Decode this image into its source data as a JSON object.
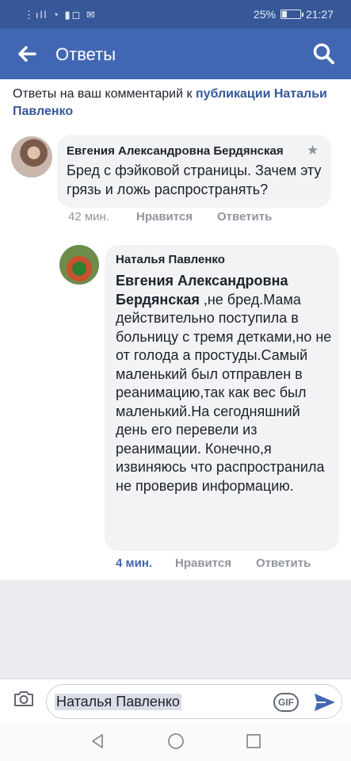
{
  "status_bar": {
    "signal_icons": "⋮ıll ◔ ▮◻ ✉",
    "battery_percent": "25%",
    "battery_level": 0.25,
    "time": "21:27"
  },
  "header": {
    "title": "Ответы",
    "back_icon": "arrow-left",
    "search_icon": "magnifier"
  },
  "context": {
    "prefix": "Ответы на ваш комментарий к ",
    "link": "публикации Натальи Павленко"
  },
  "comments": [
    {
      "author": "Евгения Александровна Бердянская",
      "badge_icon": "star",
      "text": "Бред с фэйковой страницы. Зачем эту грязь и ложь распространять?",
      "time": "42 мин.",
      "like": "Нравится",
      "reply": "Ответить"
    },
    {
      "author": "Наталья Павленко",
      "mention": "Евгения Александровна Бердянская",
      "text": " ,не бред.Мама действительно  поступила в больницу с тремя детками,но не от голода а простуды.Самый маленький был отправлен в реанимацию,так как вес был маленький.На сегодняшний день его перевели из реанимации. Конечно,я извиняюсь что распространила не проверив информацию.",
      "time": "4 мин.",
      "like": "Нравится",
      "reply": "Ответить"
    }
  ],
  "composer": {
    "value": "Наталья Павленко",
    "gif_label": "GIF",
    "camera_icon": "camera",
    "send_icon": "send-arrow"
  },
  "colors": {
    "brand": "#4267b2",
    "status_bar": "#365899",
    "link": "#365899",
    "bubble": "#f2f3f5"
  }
}
